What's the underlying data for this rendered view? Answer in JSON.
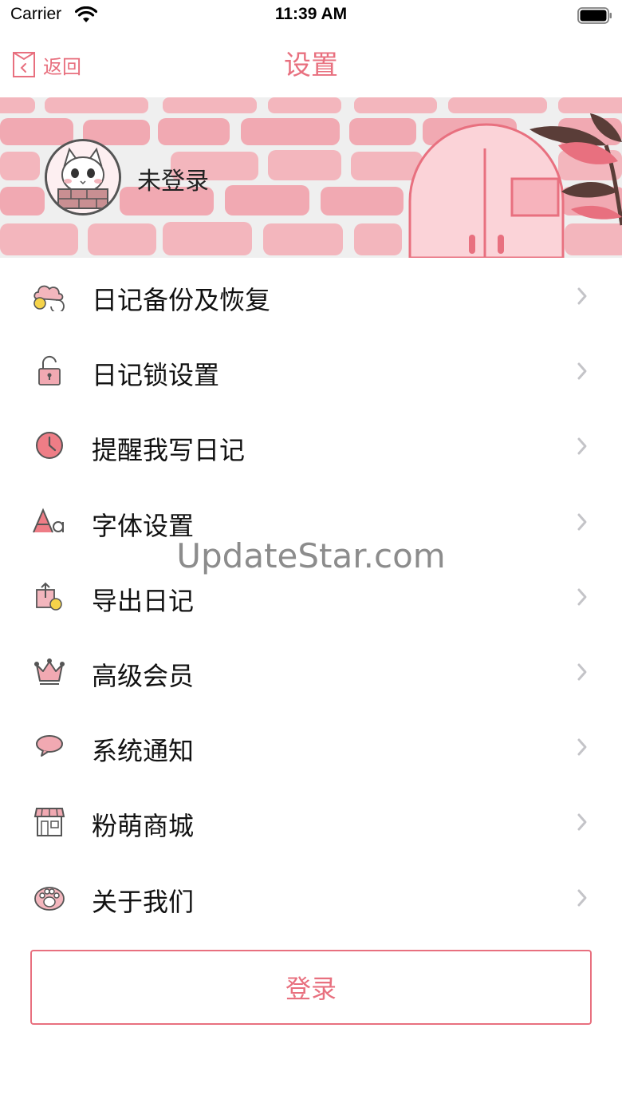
{
  "status_bar": {
    "carrier": "Carrier",
    "time": "11:39 AM"
  },
  "nav": {
    "back_label": "返回",
    "title": "设置"
  },
  "profile": {
    "name": "未登录"
  },
  "menu": [
    {
      "label": "日记备份及恢复",
      "icon": "cloud-backup-icon"
    },
    {
      "label": "日记锁设置",
      "icon": "lock-icon"
    },
    {
      "label": "提醒我写日记",
      "icon": "clock-icon"
    },
    {
      "label": "字体设置",
      "icon": "font-icon"
    },
    {
      "label": "导出日记",
      "icon": "export-icon"
    },
    {
      "label": "高级会员",
      "icon": "crown-icon"
    },
    {
      "label": "系统通知",
      "icon": "speech-bubble-icon"
    },
    {
      "label": "粉萌商城",
      "icon": "store-icon"
    },
    {
      "label": "关于我们",
      "icon": "paw-icon"
    }
  ],
  "watermark": "UpdateStar.com",
  "login_label": "登录",
  "colors": {
    "accent": "#e8707f",
    "brick": "#f1a9b2",
    "banner_bg": "#efefef"
  }
}
